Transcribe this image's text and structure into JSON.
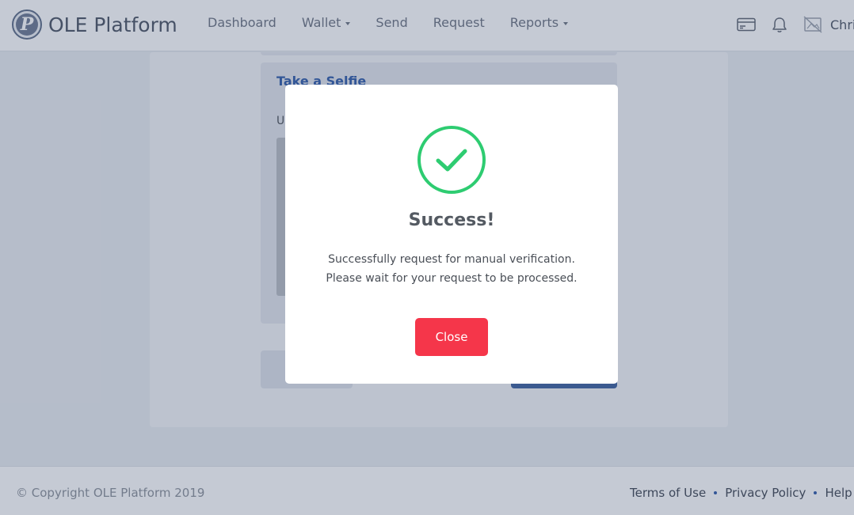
{
  "header": {
    "brand_name": "OLE Platform",
    "logo_letter": "P",
    "nav": [
      {
        "label": "Dashboard",
        "has_caret": false
      },
      {
        "label": "Wallet",
        "has_caret": true
      },
      {
        "label": "Send",
        "has_caret": false
      },
      {
        "label": "Request",
        "has_caret": false
      },
      {
        "label": "Reports",
        "has_caret": true
      }
    ],
    "icons": [
      "card-icon",
      "bell-icon",
      "avatar-placeholder-icon"
    ],
    "user_name": "Chri"
  },
  "background": {
    "panel_title": "Take a Selfie",
    "panel_text": "U"
  },
  "modal": {
    "icon": "check-circle-icon",
    "title": "Success!",
    "message_line1": "Successfully request for manual verification.",
    "message_line2": "Please wait for your request to be processed.",
    "close_label": "Close"
  },
  "footer": {
    "copyright": "© Copyright OLE Platform 2019",
    "links": [
      "Terms of Use",
      "Privacy Policy",
      "Help C"
    ]
  },
  "colors": {
    "success_green": "#2ecc71",
    "close_red": "#f5364a",
    "accent_blue": "#2d5aa8"
  }
}
